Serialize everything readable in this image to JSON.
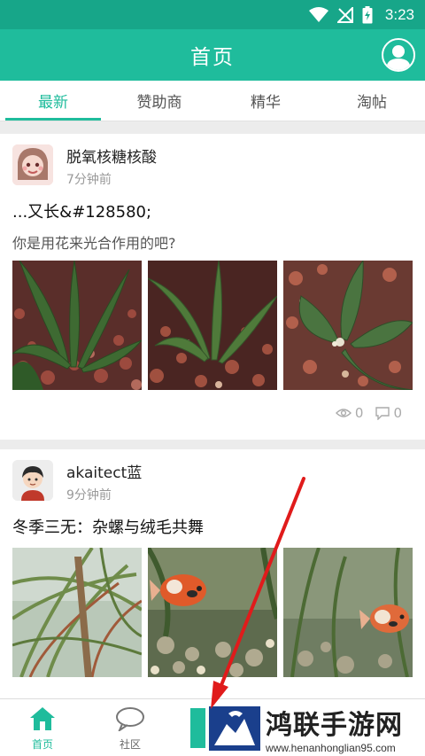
{
  "status_bar": {
    "time": "3:23"
  },
  "app_bar": {
    "title": "首页"
  },
  "tabs": [
    {
      "label": "最新",
      "active": true
    },
    {
      "label": "赞助商",
      "active": false
    },
    {
      "label": "精华",
      "active": false
    },
    {
      "label": "淘帖",
      "active": false
    }
  ],
  "posts": [
    {
      "author": "脱氧核糖核酸",
      "time": "7分钟前",
      "title": "...又长&#128580;",
      "subtitle": "你是用花来光合作用的吧?",
      "views": "0",
      "comments": "0"
    },
    {
      "author": "akaitect蓝",
      "time": "9分钟前",
      "title": "冬季三无：杂螺与绒毛共舞"
    }
  ],
  "bottom_nav": [
    {
      "label": "首页",
      "icon": "home-icon",
      "active": true
    },
    {
      "label": "社区",
      "icon": "chat-icon",
      "active": false
    }
  ],
  "watermark": {
    "title": "鸿联手游网",
    "url": "www.henanhonglian95.com"
  },
  "colors": {
    "primary": "#1fbc9c",
    "status_bar": "#17a689",
    "annotation_arrow": "#e01b1b"
  }
}
